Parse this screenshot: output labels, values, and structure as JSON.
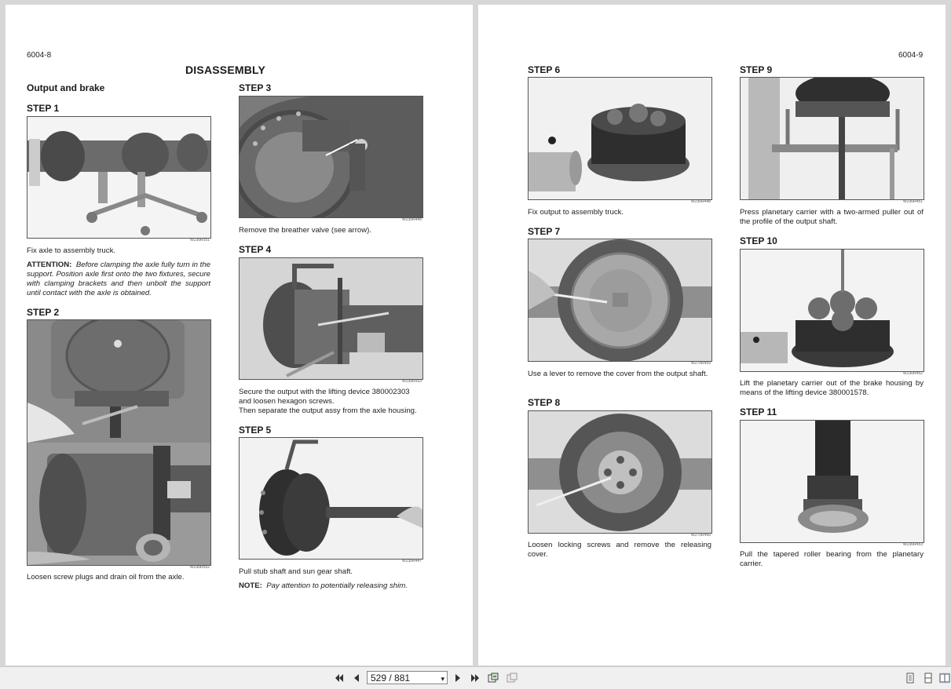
{
  "left_page": {
    "page_number": "6004-8",
    "title": "DISASSEMBLY",
    "section": "Output and brake",
    "step1": {
      "heading": "STEP 1",
      "image_code": "W230R551",
      "caption": "Fix axle to assembly truck.",
      "attention_label": "ATTENTION:",
      "attention_text": "Before clamping the axle fully turn in the support. Position axle first onto the two fixtures, secure with clamping brackets and then unbolt the support until contact with the axle is obtained."
    },
    "step2": {
      "heading": "STEP 2",
      "image_code": "W230R552",
      "caption": "Loosen screw plugs and drain oil from the axle."
    },
    "step3": {
      "heading": "STEP 3",
      "image_code": "W230R445",
      "caption": "Remove the breather valve (see arrow)."
    },
    "step4": {
      "heading": "STEP 4",
      "image_code": "W230R553",
      "caption_line1": "Secure the output with the lifting device 380002303",
      "caption_line2": "and loosen hexagon screws.",
      "caption_line3": "Then separate the output assy from the axle housing."
    },
    "step5": {
      "heading": "STEP 5",
      "image_code": "W230R447",
      "caption": "Pull stub shaft and sun gear shaft.",
      "note_label": "NOTE:",
      "note_text": "Pay attention to potentially releasing shim."
    }
  },
  "right_page": {
    "page_number": "6004-9",
    "step6": {
      "heading": "STEP 6",
      "image_code": "W230R448",
      "caption": "Fix output to assembly truck."
    },
    "step7": {
      "heading": "STEP 7",
      "image_code": "W270R459",
      "caption": "Use a lever to remove the cover from the output shaft."
    },
    "step8": {
      "heading": "STEP 8",
      "image_code": "W270R460",
      "caption": "Loosen locking screws and remove the releasing cover."
    },
    "step9": {
      "heading": "STEP 9",
      "image_code": "W230R451",
      "caption": "Press planetary carrier with a two-armed puller out of the profile of the output shaft."
    },
    "step10": {
      "heading": "STEP 10",
      "image_code": "W230R452",
      "caption": "Lift the planetary carrier out of the brake housing by means of the lifting device 380001578."
    },
    "step11": {
      "heading": "STEP 11",
      "image_code": "W230R453",
      "caption": "Pull the tapered roller bearing from the planetary carrier."
    }
  },
  "toolbar": {
    "page_indicator": "529 / 881",
    "icons": [
      "first-page-icon",
      "previous-page-icon",
      "next-page-icon",
      "last-page-icon",
      "go-back-view-icon",
      "go-forward-view-icon",
      "single-page-view-icon",
      "continuous-view-icon",
      "two-page-view-icon"
    ]
  }
}
